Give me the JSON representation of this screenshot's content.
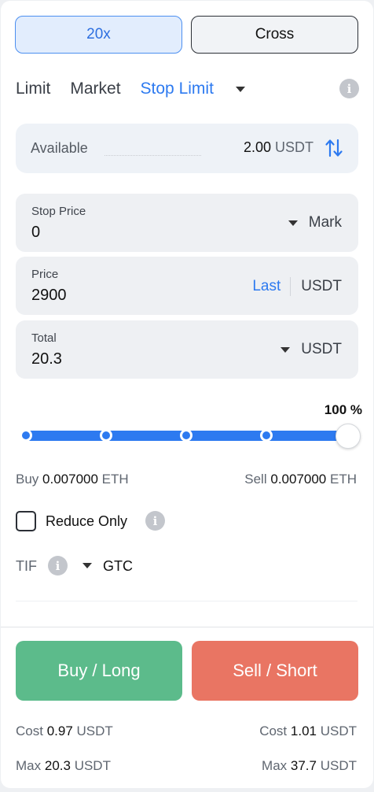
{
  "toggles": {
    "leverage": "20x",
    "margin_mode": "Cross"
  },
  "tabs": [
    {
      "label": "Limit"
    },
    {
      "label": "Market"
    },
    {
      "label": "Stop Limit"
    }
  ],
  "available": {
    "label": "Available",
    "amount": "2.00",
    "unit": "USDT"
  },
  "stop_price": {
    "label": "Stop Price",
    "value": "0",
    "trigger": "Mark"
  },
  "price": {
    "label": "Price",
    "value": "2900",
    "last": "Last",
    "unit": "USDT"
  },
  "total": {
    "label": "Total",
    "value": "20.3",
    "unit": "USDT"
  },
  "slider": {
    "percent_label": "100 %",
    "value_percent": 100
  },
  "buy_amount": {
    "label": "Buy",
    "value": "0.007000",
    "unit": "ETH"
  },
  "sell_amount": {
    "label": "Sell",
    "value": "0.007000",
    "unit": "ETH"
  },
  "reduce_only": {
    "label": "Reduce Only",
    "checked": false
  },
  "tif": {
    "label": "TIF",
    "value": "GTC"
  },
  "actions": {
    "buy": "Buy / Long",
    "sell": "Sell / Short"
  },
  "summary": {
    "buy_cost": {
      "label": "Cost",
      "value": "0.97",
      "unit": "USDT"
    },
    "sell_cost": {
      "label": "Cost",
      "value": "1.01",
      "unit": "USDT"
    },
    "buy_max": {
      "label": "Max",
      "value": "20.3",
      "unit": "USDT"
    },
    "sell_max": {
      "label": "Max",
      "value": "37.7",
      "unit": "USDT"
    }
  },
  "colors": {
    "accent": "#2d7af0",
    "buy": "#5cbb8b",
    "sell": "#e97563"
  },
  "icons": {
    "info": "info-icon",
    "swap": "swap-arrows-icon",
    "caret": "caret-down-icon"
  }
}
